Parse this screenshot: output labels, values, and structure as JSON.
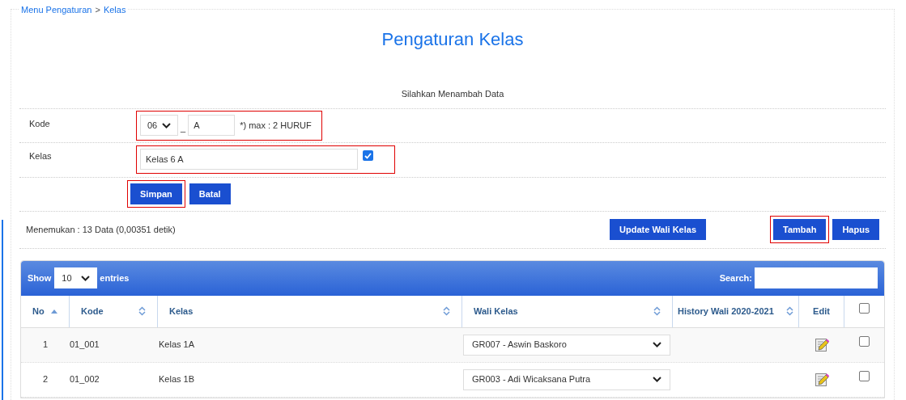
{
  "breadcrumb": [
    {
      "kind": "link",
      "text": "Menu Pengaturan"
    },
    {
      "kind": "sep",
      "text": ">"
    },
    {
      "kind": "link",
      "text": "Kelas"
    }
  ],
  "title": "Pengaturan Kelas",
  "form": {
    "heading": "Silahkan Menambah Data",
    "kode": {
      "label": "Kode",
      "select_value": "06",
      "separator": "_",
      "input_value": "A",
      "hint": "*) max : 2 HURUF",
      "highlighted": true
    },
    "kelas": {
      "label": "Kelas",
      "value": "Kelas 6 A",
      "checked": true,
      "highlighted": true
    },
    "buttons": [
      {
        "label": "Simpan",
        "highlighted": true
      },
      {
        "label": "Batal",
        "highlighted": false
      }
    ]
  },
  "result": "Menemukan : 13 Data (0,00351 detik)",
  "actions": [
    {
      "label": "Update Wali Kelas",
      "highlighted": false
    },
    {
      "label": "Tambah",
      "highlighted": true
    },
    {
      "label": "Hapus",
      "highlighted": false
    }
  ],
  "table": {
    "show_label": "Show",
    "page_size": "10",
    "entries_label": "entries",
    "search_label": "Search:",
    "columns": [
      {
        "kind": "text",
        "label": "No",
        "sortable": true,
        "sorted": true
      },
      {
        "kind": "text",
        "label": "Kode",
        "sortable": true,
        "sorted": false
      },
      {
        "kind": "text",
        "label": "Kelas",
        "sortable": true,
        "sorted": false
      },
      {
        "kind": "text",
        "label": "Wali Kelas",
        "sortable": true,
        "sorted": false
      },
      {
        "kind": "text",
        "label": "History Wali 2020-2021",
        "sortable": true,
        "sorted": false
      },
      {
        "kind": "text",
        "label": "Edit",
        "sortable": false
      },
      {
        "kind": "checkbox",
        "checked": false
      }
    ],
    "rows": [
      {
        "no": "1",
        "kode": "01_001",
        "kelas": "Kelas 1A",
        "wali": "GR007 - Aswin Baskoro",
        "checked": false
      },
      {
        "no": "2",
        "kode": "01_002",
        "kelas": "Kelas 1B",
        "wali": "GR003 - Adi Wicaksana Putra",
        "checked": false
      }
    ]
  }
}
